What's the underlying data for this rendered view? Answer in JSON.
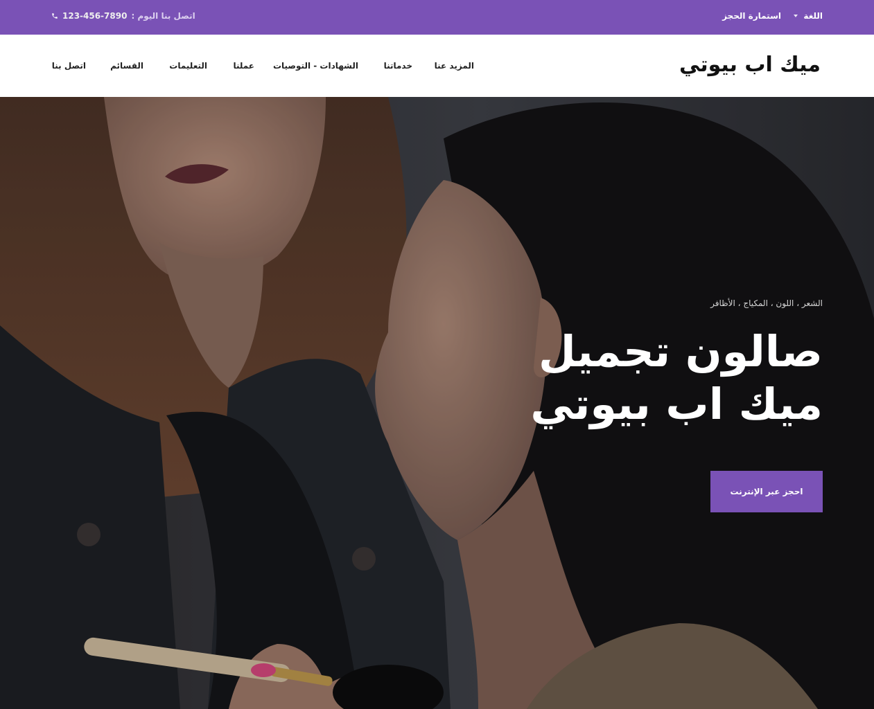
{
  "topbar": {
    "language_label": "اللغة",
    "booking_link": "استمارة الحجز",
    "call_label": "اتصل بنا اليوم :",
    "phone": "123-456-7890",
    "phone_icon": "phone-icon",
    "background_color": "#7a52b6"
  },
  "header": {
    "logo": "ميك اب بيوتي",
    "nav": [
      "المزيد عنا",
      "خدماتنا",
      "الشهادات - التوصيات",
      "عملنا",
      "التعليمات",
      "القسائم",
      "اتصل بنا"
    ]
  },
  "hero": {
    "subtitle": "الشعر ، اللون ، المكياج ، الأظافر",
    "title_line1": "صالون تجميل",
    "title_line2": "ميك اب بيوتي",
    "cta_label": "احجز عبر الإنترنت",
    "accent_color": "#7a52b6"
  }
}
